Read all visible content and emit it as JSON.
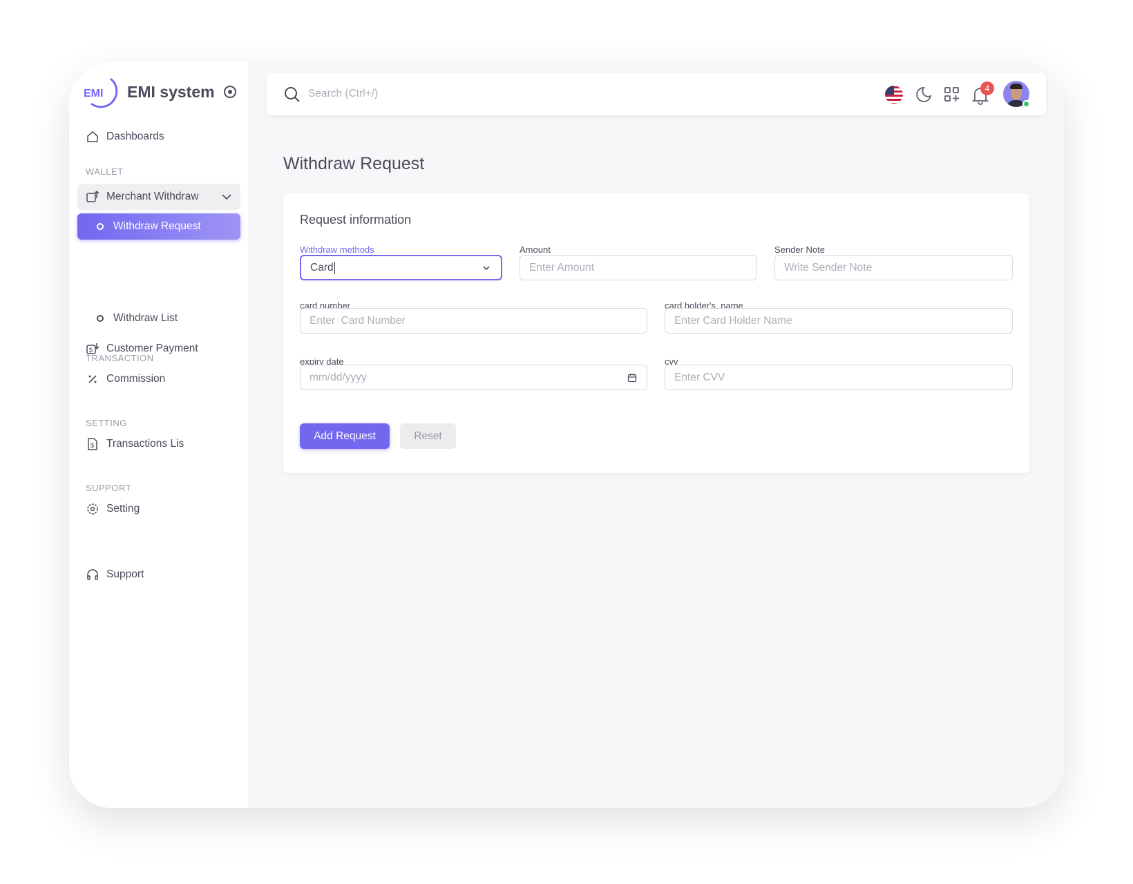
{
  "brand": {
    "name": "EMI system",
    "logo_text": "EMI"
  },
  "sidebar": {
    "dashboards": "Dashboards",
    "sections": {
      "wallet": "WALLET",
      "transaction": "TRANSACTION",
      "setting": "SETTING",
      "support": "SUPPORT"
    },
    "merchant_withdraw": "Merchant Withdraw",
    "withdraw_request": "Withdraw Request",
    "withdraw_list": "Withdraw List",
    "customer_payment": "Customer Payment",
    "commission": "Commission",
    "transactions": "Transactions Lis",
    "setting": "Setting",
    "support": "Support"
  },
  "header": {
    "search_placeholder": "Search (Ctrl+/)",
    "notification_count": "4"
  },
  "page": {
    "title": "Withdraw Request"
  },
  "form": {
    "section_title": "Request information",
    "withdraw_methods": {
      "label": "Withdraw methods",
      "value": "Card"
    },
    "amount": {
      "label": "Amount",
      "placeholder": "Enter Amount"
    },
    "sender_note": {
      "label": "Sender Note",
      "placeholder": "Write Sender Note"
    },
    "card_number": {
      "label": "card number",
      "placeholder": "Enter  Card Number"
    },
    "holder": {
      "label": "card holder's_name",
      "placeholder": "Enter Card Holder Name"
    },
    "expiry": {
      "label": "expiry date",
      "placeholder": "mm/dd/yyyy"
    },
    "cvv": {
      "label": "cvv",
      "placeholder": "Enter CVV"
    },
    "add_button": "Add Request",
    "reset_button": "Reset"
  },
  "colors": {
    "accent": "#7367f0",
    "badge": "#ea5455",
    "online": "#28c76f"
  }
}
